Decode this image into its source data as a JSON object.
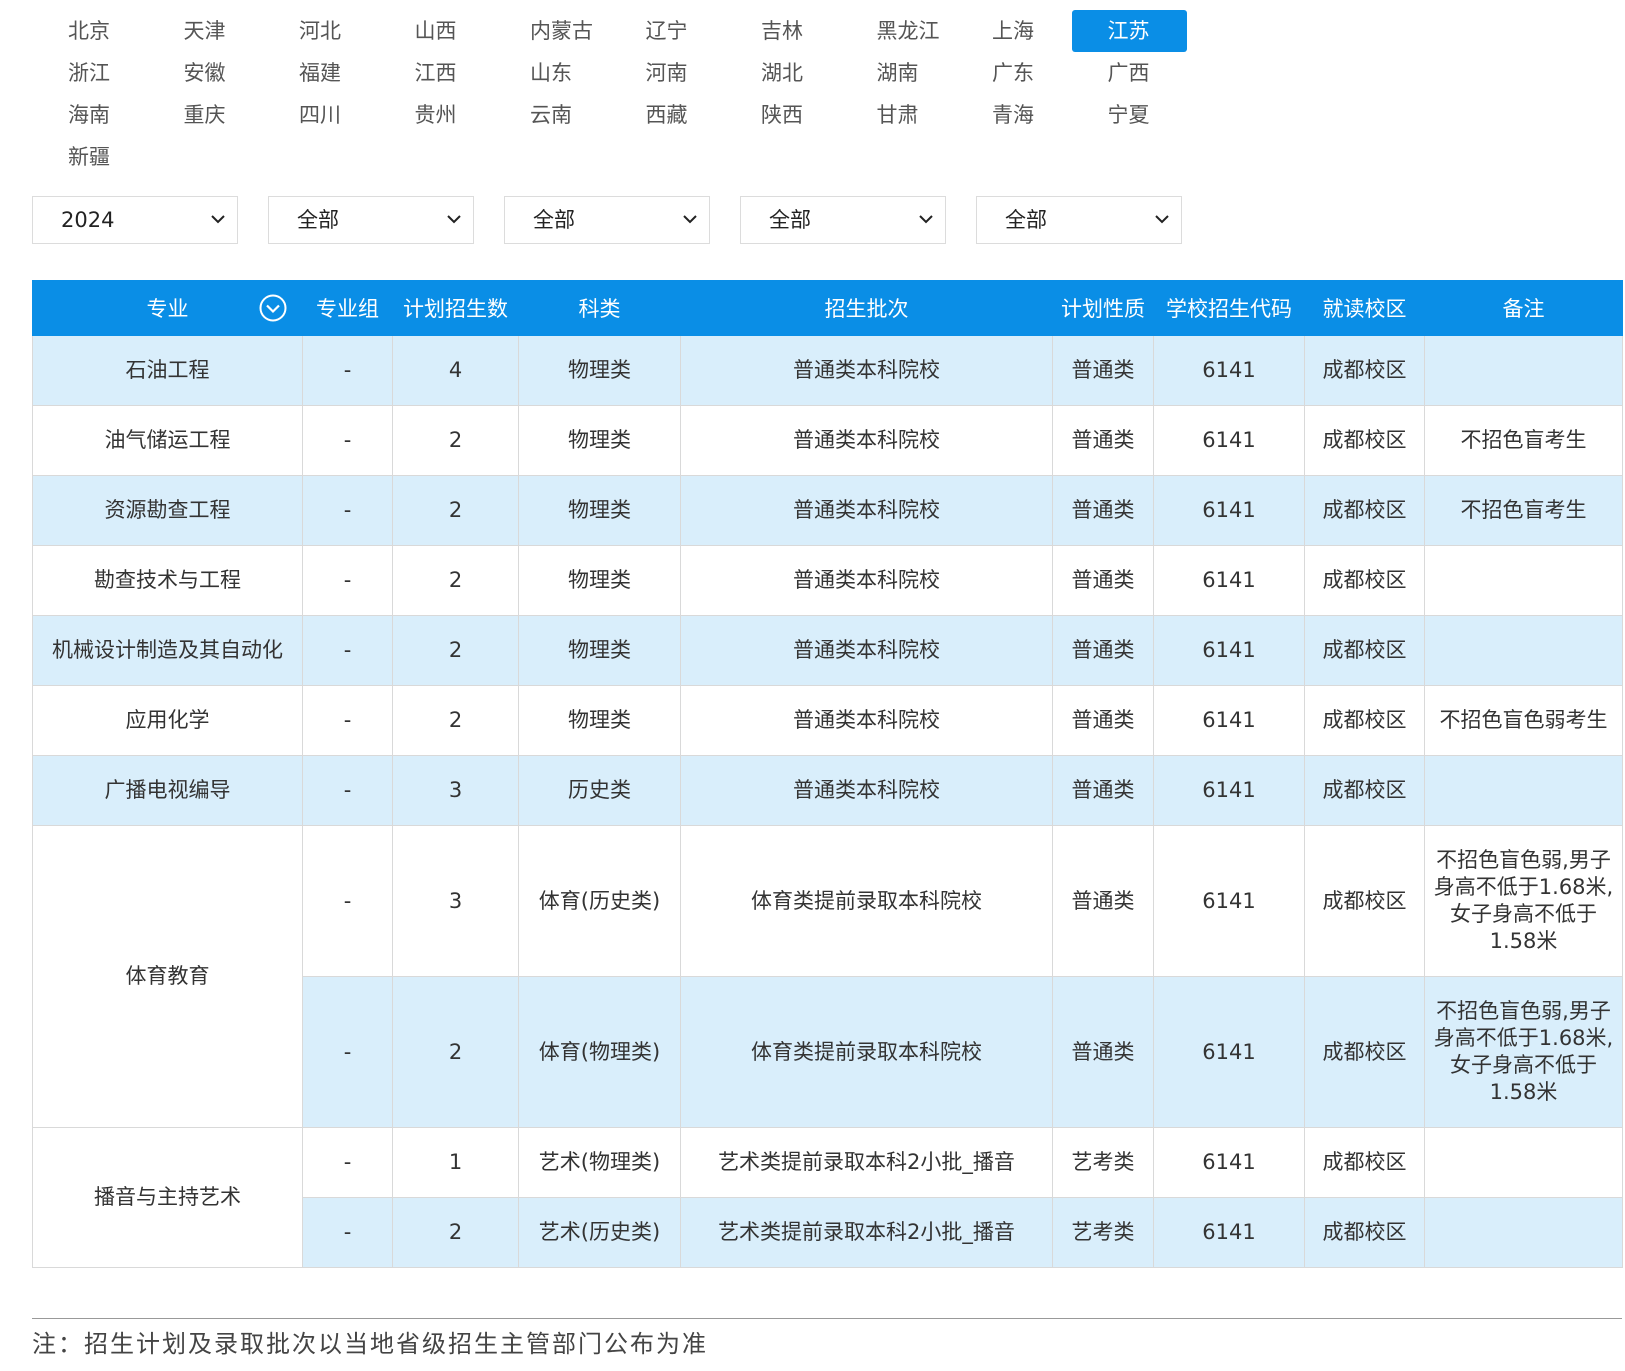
{
  "provinces": [
    "北京",
    "天津",
    "河北",
    "山西",
    "内蒙古",
    "辽宁",
    "吉林",
    "黑龙江",
    "上海",
    "江苏",
    "浙江",
    "安徽",
    "福建",
    "江西",
    "山东",
    "河南",
    "湖北",
    "湖南",
    "广东",
    "广西",
    "海南",
    "重庆",
    "四川",
    "贵州",
    "云南",
    "西藏",
    "陕西",
    "甘肃",
    "青海",
    "宁夏",
    "新疆"
  ],
  "active_province": "江苏",
  "filters": {
    "year": "2024",
    "f1": "全部",
    "f2": "全部",
    "f3": "全部",
    "f4": "全部"
  },
  "table": {
    "headers": [
      "专业",
      "专业组",
      "计划招生数",
      "科类",
      "招生批次",
      "计划性质",
      "学校招生代码",
      "就读校区",
      "备注"
    ],
    "rows": [
      {
        "major": "石油工程",
        "group": "-",
        "count": "4",
        "category": "物理类",
        "batch": "普通类本科院校",
        "nature": "普通类",
        "code": "6141",
        "campus": "成都校区",
        "note": ""
      },
      {
        "major": "油气储运工程",
        "group": "-",
        "count": "2",
        "category": "物理类",
        "batch": "普通类本科院校",
        "nature": "普通类",
        "code": "6141",
        "campus": "成都校区",
        "note": "不招色盲考生"
      },
      {
        "major": "资源勘查工程",
        "group": "-",
        "count": "2",
        "category": "物理类",
        "batch": "普通类本科院校",
        "nature": "普通类",
        "code": "6141",
        "campus": "成都校区",
        "note": "不招色盲考生"
      },
      {
        "major": "勘查技术与工程",
        "group": "-",
        "count": "2",
        "category": "物理类",
        "batch": "普通类本科院校",
        "nature": "普通类",
        "code": "6141",
        "campus": "成都校区",
        "note": ""
      },
      {
        "major": "机械设计制造及其自动化",
        "group": "-",
        "count": "2",
        "category": "物理类",
        "batch": "普通类本科院校",
        "nature": "普通类",
        "code": "6141",
        "campus": "成都校区",
        "note": ""
      },
      {
        "major": "应用化学",
        "group": "-",
        "count": "2",
        "category": "物理类",
        "batch": "普通类本科院校",
        "nature": "普通类",
        "code": "6141",
        "campus": "成都校区",
        "note": "不招色盲色弱考生"
      },
      {
        "major": "广播电视编导",
        "group": "-",
        "count": "3",
        "category": "历史类",
        "batch": "普通类本科院校",
        "nature": "普通类",
        "code": "6141",
        "campus": "成都校区",
        "note": ""
      },
      {
        "major": "体育教育",
        "group": "-",
        "count": "3",
        "category": "体育(历史类)",
        "batch": "体育类提前录取本科院校",
        "nature": "普通类",
        "code": "6141",
        "campus": "成都校区",
        "note": "不招色盲色弱,男子身高不低于1.68米,女子身高不低于1.58米"
      },
      {
        "major": "",
        "group": "-",
        "count": "2",
        "category": "体育(物理类)",
        "batch": "体育类提前录取本科院校",
        "nature": "普通类",
        "code": "6141",
        "campus": "成都校区",
        "note": "不招色盲色弱,男子身高不低于1.68米,女子身高不低于1.58米"
      },
      {
        "major": "播音与主持艺术",
        "group": "-",
        "count": "1",
        "category": "艺术(物理类)",
        "batch": "艺术类提前录取本科2小批_播音",
        "nature": "艺考类",
        "code": "6141",
        "campus": "成都校区",
        "note": ""
      },
      {
        "major": "",
        "group": "-",
        "count": "2",
        "category": "艺术(历史类)",
        "batch": "艺术类提前录取本科2小批_播音",
        "nature": "艺考类",
        "code": "6141",
        "campus": "成都校区",
        "note": ""
      }
    ]
  },
  "footnote": "注：招生计划及录取批次以当地省级招生主管部门公布为准",
  "colors": {
    "accent": "#0a8ee6",
    "row_alt": "#d9eefb"
  },
  "icons": {
    "header_sort": "chevron-circle-down-icon",
    "select": "chevron-down-icon"
  }
}
